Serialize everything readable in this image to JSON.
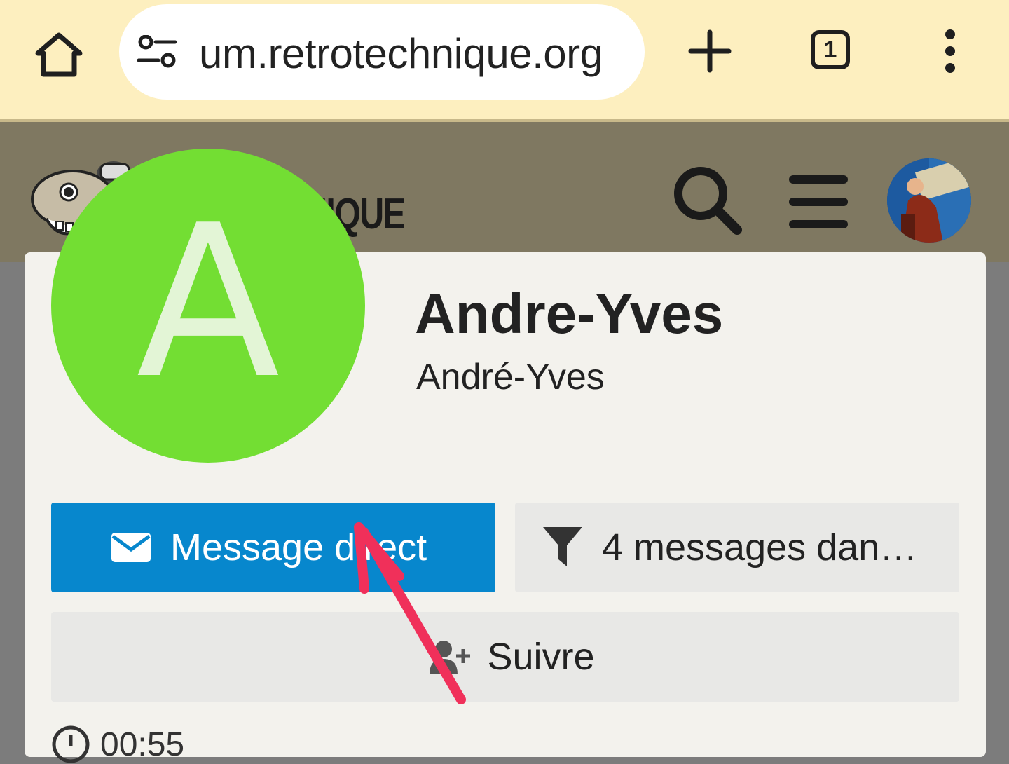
{
  "browser": {
    "url": "um.retrotechnique.org",
    "tab_count": "1",
    "icons": {
      "home": "home-icon",
      "site_info": "tune-icon",
      "new_tab": "plus-icon",
      "menu": "kebab-icon"
    }
  },
  "site": {
    "logo_text": "NIQUE",
    "icons": {
      "search": "search-icon",
      "menu": "hamburger-icon",
      "avatar": "user-avatar"
    }
  },
  "profile": {
    "avatar_letter": "A",
    "avatar_color": "#73de33",
    "username": "Andre-Yves",
    "full_name": "André-Yves",
    "message_button": "Message direct",
    "filter_button": "4 messages dan…",
    "follow_button": "Suivre",
    "last_seen": "00:55"
  },
  "colors": {
    "primary_button": "#0787cd",
    "chrome_bg": "#fdefbf",
    "annotation": "#f0305a"
  }
}
